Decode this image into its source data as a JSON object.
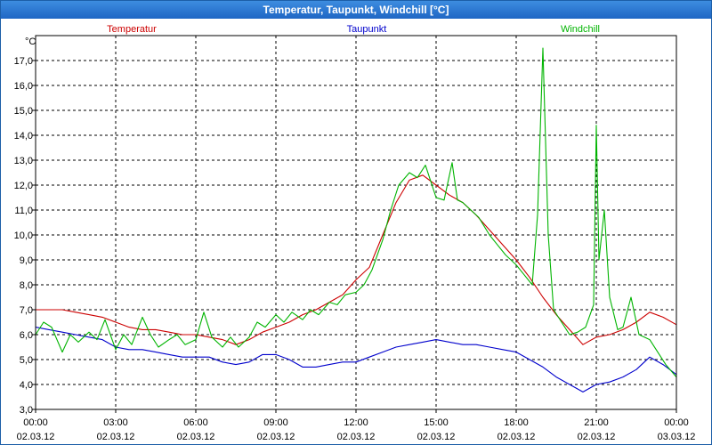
{
  "window": {
    "title": "Temperatur, Taupunkt, Windchill [°C]"
  },
  "chart_data": {
    "type": "line",
    "title": "Temperatur, Taupunkt, Windchill [°C]",
    "ylabel": "°C",
    "ylim": [
      3.0,
      18.0
    ],
    "xlim_hours": [
      0,
      24
    ],
    "grid": true,
    "legend_placement": "top",
    "y_ticks": [
      "3,0",
      "4,0",
      "5,0",
      "6,0",
      "7,0",
      "8,0",
      "9,0",
      "10,0",
      "11,0",
      "12,0",
      "13,0",
      "14,0",
      "15,0",
      "16,0",
      "17,0"
    ],
    "x_ticks": [
      {
        "time": "00:00",
        "date": "02.03.12"
      },
      {
        "time": "03:00",
        "date": "02.03.12"
      },
      {
        "time": "06:00",
        "date": "02.03.12"
      },
      {
        "time": "09:00",
        "date": "02.03.12"
      },
      {
        "time": "12:00",
        "date": "02.03.12"
      },
      {
        "time": "15:00",
        "date": "02.03.12"
      },
      {
        "time": "18:00",
        "date": "02.03.12"
      },
      {
        "time": "21:00",
        "date": "02.03.12"
      },
      {
        "time": "00:00",
        "date": "03.03.12"
      }
    ],
    "series": [
      {
        "name": "Temperatur",
        "color": "#cc0000",
        "points": [
          [
            0,
            7.0
          ],
          [
            0.5,
            7.0
          ],
          [
            1,
            7.0
          ],
          [
            1.5,
            6.9
          ],
          [
            2,
            6.8
          ],
          [
            2.5,
            6.7
          ],
          [
            3,
            6.5
          ],
          [
            3.5,
            6.3
          ],
          [
            4,
            6.2
          ],
          [
            4.5,
            6.2
          ],
          [
            5,
            6.1
          ],
          [
            5.5,
            6.0
          ],
          [
            6,
            6.0
          ],
          [
            6.5,
            5.9
          ],
          [
            7,
            5.8
          ],
          [
            7.5,
            5.6
          ],
          [
            8,
            5.8
          ],
          [
            8.5,
            6.1
          ],
          [
            9,
            6.3
          ],
          [
            9.5,
            6.5
          ],
          [
            10,
            6.8
          ],
          [
            10.5,
            7.0
          ],
          [
            11,
            7.3
          ],
          [
            11.5,
            7.6
          ],
          [
            12,
            8.2
          ],
          [
            12.5,
            8.7
          ],
          [
            13,
            10.0
          ],
          [
            13.5,
            11.3
          ],
          [
            14,
            12.2
          ],
          [
            14.5,
            12.4
          ],
          [
            15,
            12.0
          ],
          [
            15.5,
            11.6
          ],
          [
            16,
            11.3
          ],
          [
            16.5,
            10.8
          ],
          [
            17,
            10.2
          ],
          [
            17.5,
            9.6
          ],
          [
            18,
            9.0
          ],
          [
            18.5,
            8.3
          ],
          [
            19,
            7.5
          ],
          [
            19.5,
            6.8
          ],
          [
            20,
            6.2
          ],
          [
            20.5,
            5.6
          ],
          [
            21,
            5.9
          ],
          [
            21.5,
            6.0
          ],
          [
            22,
            6.2
          ],
          [
            22.5,
            6.5
          ],
          [
            23,
            6.9
          ],
          [
            23.5,
            6.7
          ],
          [
            24,
            6.4
          ]
        ]
      },
      {
        "name": "Taupunkt",
        "color": "#0000cc",
        "points": [
          [
            0,
            6.3
          ],
          [
            0.5,
            6.2
          ],
          [
            1,
            6.1
          ],
          [
            1.5,
            6.0
          ],
          [
            2,
            5.9
          ],
          [
            2.5,
            5.8
          ],
          [
            3,
            5.5
          ],
          [
            3.5,
            5.4
          ],
          [
            4,
            5.4
          ],
          [
            4.5,
            5.3
          ],
          [
            5,
            5.2
          ],
          [
            5.5,
            5.1
          ],
          [
            6,
            5.1
          ],
          [
            6.5,
            5.1
          ],
          [
            7,
            4.9
          ],
          [
            7.5,
            4.8
          ],
          [
            8,
            4.9
          ],
          [
            8.5,
            5.2
          ],
          [
            9,
            5.2
          ],
          [
            9.5,
            5.0
          ],
          [
            10,
            4.7
          ],
          [
            10.5,
            4.7
          ],
          [
            11,
            4.8
          ],
          [
            11.5,
            4.9
          ],
          [
            12,
            4.9
          ],
          [
            12.5,
            5.1
          ],
          [
            13,
            5.3
          ],
          [
            13.5,
            5.5
          ],
          [
            14,
            5.6
          ],
          [
            14.5,
            5.7
          ],
          [
            15,
            5.8
          ],
          [
            15.5,
            5.7
          ],
          [
            16,
            5.6
          ],
          [
            16.5,
            5.6
          ],
          [
            17,
            5.5
          ],
          [
            17.5,
            5.4
          ],
          [
            18,
            5.3
          ],
          [
            18.5,
            5.0
          ],
          [
            19,
            4.7
          ],
          [
            19.5,
            4.3
          ],
          [
            20,
            4.0
          ],
          [
            20.5,
            3.7
          ],
          [
            21,
            4.0
          ],
          [
            21.5,
            4.1
          ],
          [
            22,
            4.3
          ],
          [
            22.5,
            4.6
          ],
          [
            23,
            5.1
          ],
          [
            23.5,
            4.8
          ],
          [
            24,
            4.4
          ]
        ]
      },
      {
        "name": "Windchill",
        "color": "#00b400",
        "points": [
          [
            0,
            6.0
          ],
          [
            0.3,
            6.5
          ],
          [
            0.6,
            6.3
          ],
          [
            1,
            5.3
          ],
          [
            1.3,
            6.0
          ],
          [
            1.6,
            5.7
          ],
          [
            2,
            6.1
          ],
          [
            2.3,
            5.8
          ],
          [
            2.6,
            6.6
          ],
          [
            3,
            5.4
          ],
          [
            3.3,
            6.0
          ],
          [
            3.6,
            5.6
          ],
          [
            4,
            6.7
          ],
          [
            4.3,
            6.0
          ],
          [
            4.6,
            5.5
          ],
          [
            5,
            5.8
          ],
          [
            5.3,
            6.0
          ],
          [
            5.6,
            5.6
          ],
          [
            6,
            5.8
          ],
          [
            6.3,
            6.9
          ],
          [
            6.6,
            5.9
          ],
          [
            7,
            5.5
          ],
          [
            7.3,
            5.9
          ],
          [
            7.6,
            5.5
          ],
          [
            8,
            5.9
          ],
          [
            8.3,
            6.5
          ],
          [
            8.6,
            6.3
          ],
          [
            9,
            6.8
          ],
          [
            9.3,
            6.5
          ],
          [
            9.6,
            6.9
          ],
          [
            10,
            6.6
          ],
          [
            10.3,
            7.0
          ],
          [
            10.6,
            6.8
          ],
          [
            11,
            7.3
          ],
          [
            11.3,
            7.2
          ],
          [
            11.6,
            7.6
          ],
          [
            12,
            7.7
          ],
          [
            12.3,
            8.0
          ],
          [
            12.6,
            8.6
          ],
          [
            13,
            9.8
          ],
          [
            13.3,
            11.0
          ],
          [
            13.6,
            12.0
          ],
          [
            14,
            12.5
          ],
          [
            14.3,
            12.3
          ],
          [
            14.6,
            12.8
          ],
          [
            15,
            11.5
          ],
          [
            15.3,
            11.4
          ],
          [
            15.6,
            12.9
          ],
          [
            15.8,
            11.4
          ],
          [
            16,
            11.3
          ],
          [
            16.3,
            11.0
          ],
          [
            16.6,
            10.7
          ],
          [
            17,
            10.0
          ],
          [
            17.3,
            9.6
          ],
          [
            17.6,
            9.2
          ],
          [
            18,
            8.8
          ],
          [
            18.3,
            8.4
          ],
          [
            18.6,
            8.0
          ],
          [
            18.8,
            10.8
          ],
          [
            19,
            17.5
          ],
          [
            19.2,
            10.0
          ],
          [
            19.4,
            7.0
          ],
          [
            19.7,
            6.5
          ],
          [
            20,
            6.0
          ],
          [
            20.3,
            6.1
          ],
          [
            20.6,
            6.3
          ],
          [
            20.9,
            7.2
          ],
          [
            21,
            14.4
          ],
          [
            21.1,
            9.0
          ],
          [
            21.3,
            11.0
          ],
          [
            21.5,
            7.5
          ],
          [
            21.8,
            6.2
          ],
          [
            22,
            6.3
          ],
          [
            22.3,
            7.5
          ],
          [
            22.6,
            6.0
          ],
          [
            23,
            5.8
          ],
          [
            23.3,
            5.3
          ],
          [
            23.6,
            4.8
          ],
          [
            24,
            4.3
          ]
        ]
      }
    ]
  }
}
